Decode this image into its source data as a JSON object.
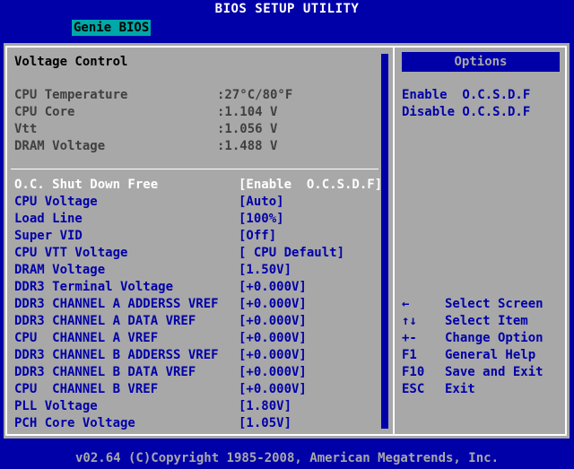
{
  "header": {
    "title": "BIOS SETUP UTILITY",
    "tab": "Genie BIOS"
  },
  "main": {
    "section_title": "Voltage Control",
    "readonly": [
      {
        "label": "CPU Temperature",
        "value": ":27°C/80°F"
      },
      {
        "label": "CPU Core",
        "value": ":1.104 V"
      },
      {
        "label": "Vtt",
        "value": ":1.056 V"
      },
      {
        "label": "DRAM Voltage",
        "value": ":1.488 V"
      }
    ],
    "items": [
      {
        "label": "O.C. Shut Down Free",
        "value": "[Enable  O.C.S.D.F]"
      },
      {
        "label": "CPU Voltage",
        "value": "[Auto]"
      },
      {
        "label": "Load Line",
        "value": "[100%]"
      },
      {
        "label": "Super VID",
        "value": "[Off]"
      },
      {
        "label": "CPU VTT Voltage",
        "value": "[ CPU Default]"
      },
      {
        "label": "DRAM Voltage",
        "value": "[1.50V]"
      },
      {
        "label": "DDR3 Terminal Voltage",
        "value": "[+0.000V]"
      },
      {
        "label": "DDR3 CHANNEL A ADDERSS VREF",
        "value": "[+0.000V]"
      },
      {
        "label": "DDR3 CHANNEL A DATA VREF",
        "value": "[+0.000V]"
      },
      {
        "label": "CPU  CHANNEL A VREF",
        "value": "[+0.000V]"
      },
      {
        "label": "DDR3 CHANNEL B ADDERSS VREF",
        "value": "[+0.000V]"
      },
      {
        "label": "DDR3 CHANNEL B DATA VREF",
        "value": "[+0.000V]"
      },
      {
        "label": "CPU  CHANNEL B VREF",
        "value": "[+0.000V]"
      },
      {
        "label": "PLL Voltage",
        "value": "[1.80V]"
      },
      {
        "label": "PCH Core Voltage",
        "value": "[1.05V]"
      }
    ]
  },
  "options": {
    "title": "Options",
    "items": [
      "Enable  O.C.S.D.F",
      "Disable O.C.S.D.F"
    ]
  },
  "help": [
    {
      "key": "←",
      "desc": "Select Screen"
    },
    {
      "key": "↑↓",
      "desc": "Select Item"
    },
    {
      "key": "+-",
      "desc": "Change Option"
    },
    {
      "key": "F1",
      "desc": "General Help"
    },
    {
      "key": "F10",
      "desc": "Save and Exit"
    },
    {
      "key": "ESC",
      "desc": "Exit"
    }
  ],
  "footer": {
    "copyright": "v02.64 (C)Copyright 1985-2008, American Megatrends, Inc."
  },
  "colors": {
    "bios_blue": "#0000a8",
    "panel_gray": "#a8a8a8",
    "highlight_cyan": "#00a8a8"
  },
  "icons": {
    "scroll_up": "triangle-up-icon",
    "scroll_down": "triangle-down-icon"
  }
}
